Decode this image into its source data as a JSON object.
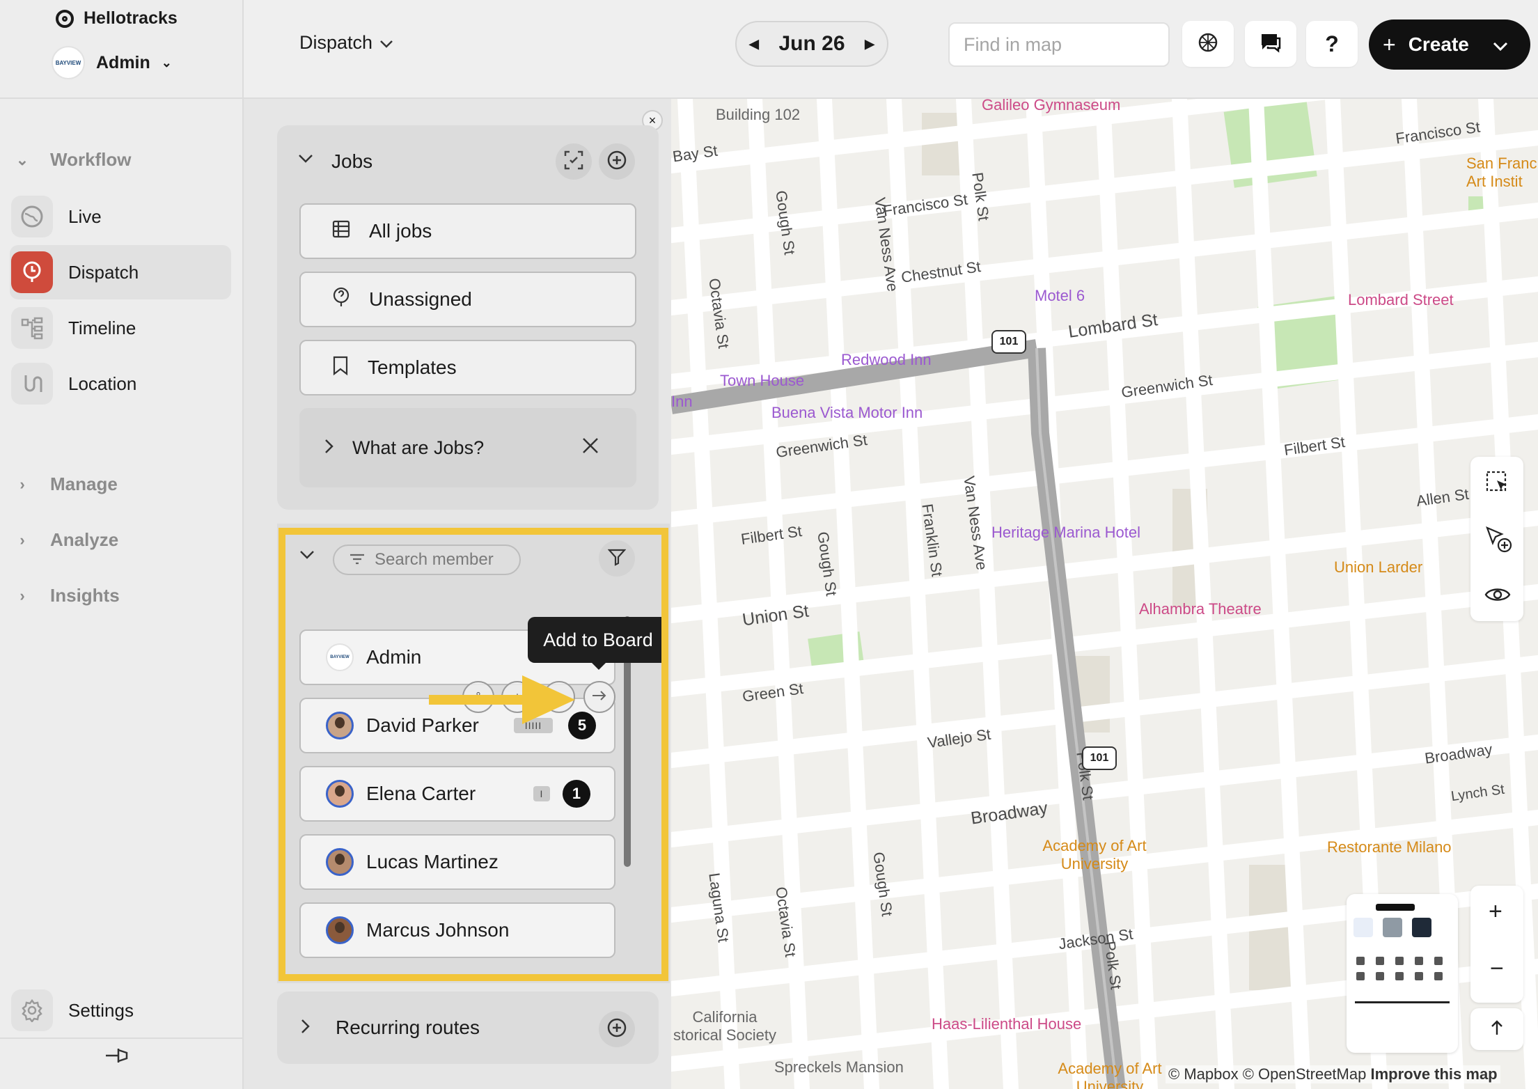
{
  "app": {
    "name": "Hellotracks",
    "org": "Admin",
    "org_logo_text": "BAYVIEW"
  },
  "sidebar": {
    "workflow_label": "Workflow",
    "items": [
      {
        "label": "Live",
        "icon": "globe-icon"
      },
      {
        "label": "Dispatch",
        "icon": "dispatch-icon",
        "active": true
      },
      {
        "label": "Timeline",
        "icon": "timeline-icon"
      },
      {
        "label": "Location",
        "icon": "location-route-icon"
      }
    ],
    "sections": [
      "Manage",
      "Analyze",
      "Insights"
    ],
    "settings_label": "Settings"
  },
  "topbar": {
    "breadcrumb": "Dispatch",
    "date": "Jun 26",
    "search_placeholder": "Find in map",
    "create_label": "Create"
  },
  "jobs": {
    "title": "Jobs",
    "buttons": [
      "All jobs",
      "Unassigned",
      "Templates"
    ],
    "help_label": "What are Jobs?"
  },
  "members": {
    "search_placeholder": "Search member",
    "tooltip": "Add to Board",
    "rows": [
      {
        "name": "Admin",
        "count": "",
        "bars": ""
      },
      {
        "name": "David Parker",
        "count": "5",
        "bars": "IIIII"
      },
      {
        "name": "Elena Carter",
        "count": "1",
        "bars": "I"
      },
      {
        "name": "Lucas Martinez",
        "count": "",
        "bars": ""
      },
      {
        "name": "Marcus Johnson",
        "count": "",
        "bars": ""
      }
    ]
  },
  "recurring": {
    "label": "Recurring routes"
  },
  "map": {
    "streets": [
      "Bay St",
      "Francisco St",
      "Chestnut St",
      "Lombard St",
      "Greenwich St",
      "Filbert St",
      "Union St",
      "Green St",
      "Vallejo St",
      "Broadway",
      "Jackson St",
      "Van Ness Ave",
      "Franklin St",
      "Gough St",
      "Octavia St",
      "Laguna St",
      "Polk St",
      "Allen St",
      "Lynch St",
      "Francisco St"
    ],
    "pois": [
      "Galileo Gymnaseum",
      "Building 102",
      "Motel 6",
      "Redwood Inn",
      "Town House",
      "Buena Vista Motor Inn",
      "Heritage Marina Hotel",
      "Alhambra Theatre",
      "Union Larder",
      "Lombard Street",
      "San Franc Art Instit",
      "Academy of Art University",
      "Restorante Milano",
      "Haas-Lilienthal House",
      "California storical Society",
      "Spreckels Mansion",
      "Academy of Art University",
      "Inn"
    ],
    "highway": "101",
    "attribution_1": "© Mapbox © OpenStreetMap",
    "attribution_2": "Improve this map"
  },
  "colors": {
    "accent": "#cf4b3c",
    "highlight": "#f2c539",
    "poi_purple": "#9b59d0",
    "poi_orange": "#d58a18",
    "poi_pink": "#cc4a87"
  }
}
